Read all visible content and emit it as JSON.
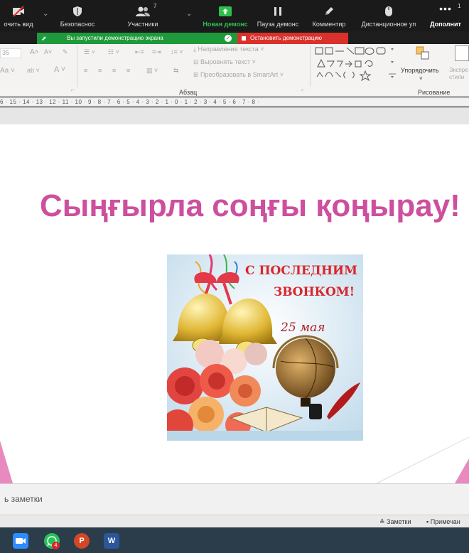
{
  "zoom_toolbar": {
    "buttons": [
      {
        "label": "очить вид",
        "icon": "video-off-icon"
      },
      {
        "label": "Безопаснос",
        "icon": "shield-icon"
      },
      {
        "label": "Участники",
        "icon": "participants-icon",
        "count": "7"
      },
      {
        "label": "Новая демонс",
        "icon": "share-screen-icon"
      },
      {
        "label": "Пауза демонс",
        "icon": "pause-icon"
      },
      {
        "label": "Комментир",
        "icon": "pencil-icon"
      },
      {
        "label": "Дистанционное уп",
        "icon": "mouse-icon"
      },
      {
        "label": "Дополнит",
        "icon": "more-icon",
        "count": "1"
      }
    ],
    "share_banner": "Вы запустили демонстрацию экрана",
    "stop_button": "Остановить демонстрацию",
    "accent_green": "#1f9a3a",
    "accent_red": "#d9312b"
  },
  "ribbon": {
    "font_size_value": "35",
    "text_direction": "Направление текста",
    "align_text": "Выровнять текст",
    "convert_smartart": "Преобразовать в SmartArt",
    "paragraph_group": "Абзац",
    "arrange_label": "Упорядочить",
    "express_styles": "Экспре стили",
    "drawing_group": "Рисование"
  },
  "ruler": {
    "marks": "6 · 15 · 14 · 13 · 12 · 11 · 10 · 9 · 8 · 7 · 6 · 5 · 4 · 3 · 2 · 1 · 0 · 1 · 2 · 3 · 4 · 5 · 6 · 7 · 8 ·"
  },
  "slide": {
    "title": "Сыңғырла соңғы қоңырау!",
    "title_color": "#cd4f9e",
    "image": {
      "line1": "С ПОСЛЕДНИМ",
      "line2": "ЗВОНКОМ!",
      "date": "25 мая"
    }
  },
  "notes": {
    "placeholder": "ь заметки"
  },
  "status_bar": {
    "notes_label": "Заметки",
    "comments_label": "Примечан"
  },
  "taskbar": {
    "apps": [
      {
        "name": "zoom-taskbar-icon"
      },
      {
        "name": "whatsapp-taskbar-icon",
        "badge": "4"
      },
      {
        "name": "powerpoint-taskbar-icon"
      },
      {
        "name": "word-taskbar-icon"
      }
    ]
  }
}
